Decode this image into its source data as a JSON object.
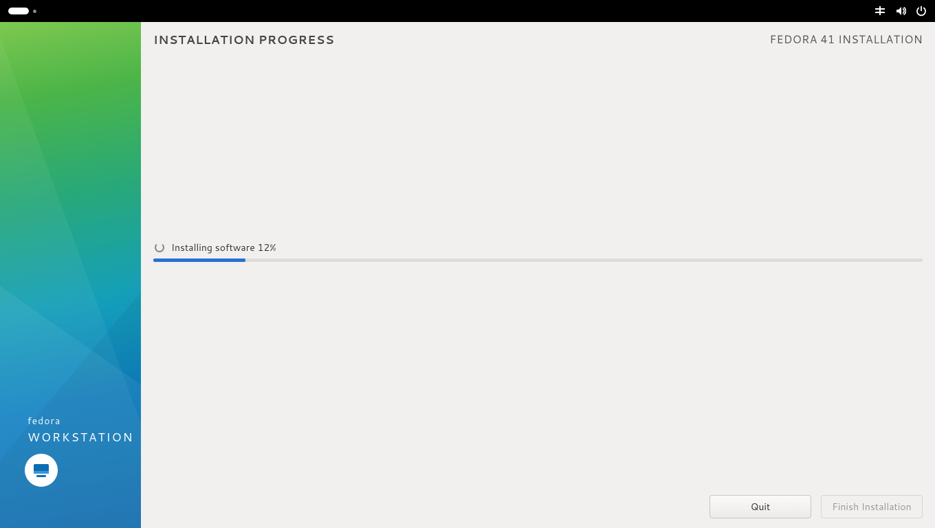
{
  "header": {
    "page_title": "INSTALLATION PROGRESS",
    "product_title": "FEDORA 41 INSTALLATION"
  },
  "sidebar": {
    "brand_top": "fedora",
    "brand_bottom": "WORKSTATION"
  },
  "progress": {
    "status_text": "Installing software 12%",
    "percent": 12
  },
  "buttons": {
    "quit": "Quit",
    "finish": "Finish Installation"
  },
  "colors": {
    "progress_fill": "#2a6fd6"
  }
}
